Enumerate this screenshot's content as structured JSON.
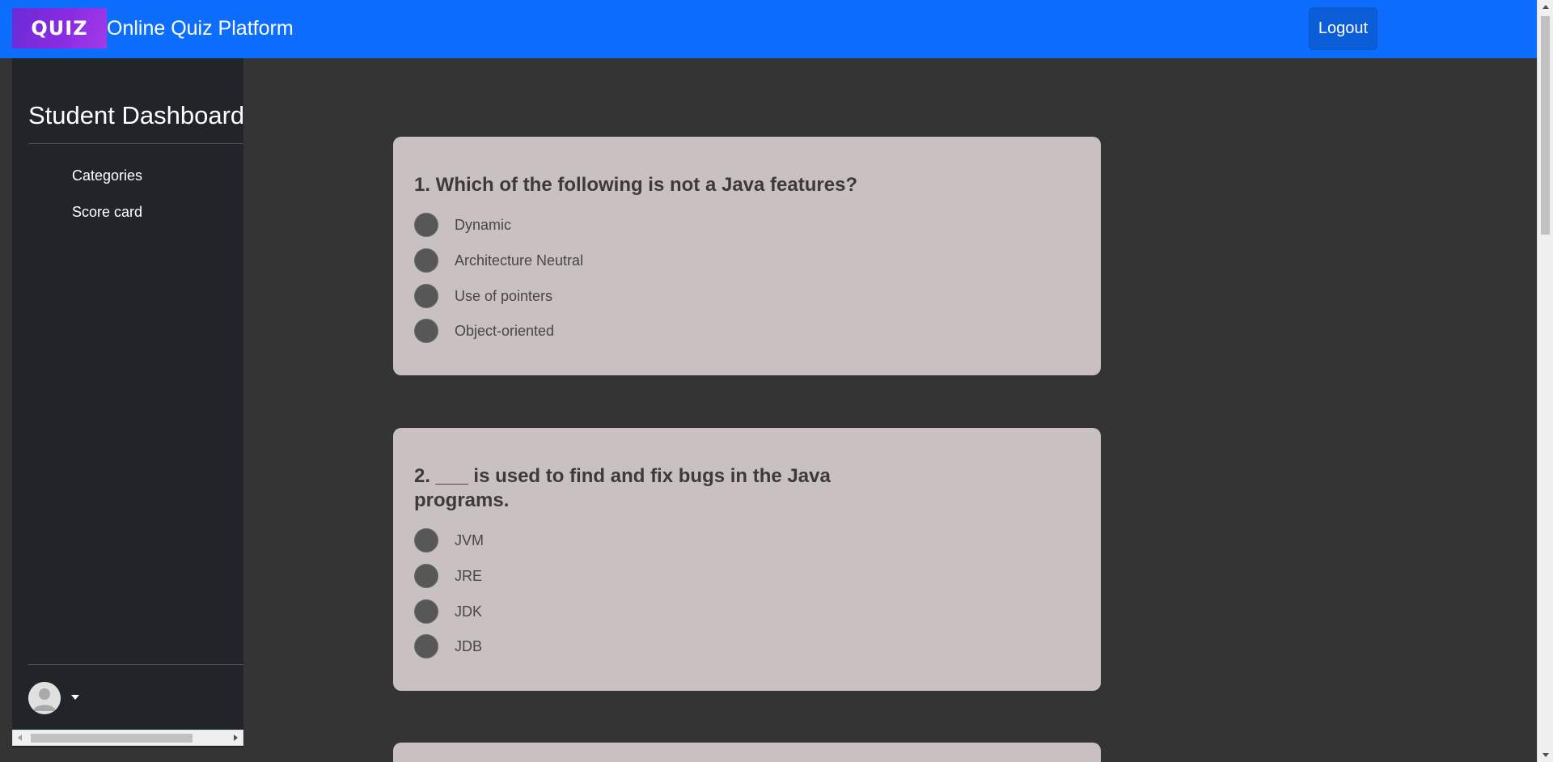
{
  "header": {
    "logo_text": "QUIZ",
    "title": "Online Quiz Platform",
    "logout_label": "Logout"
  },
  "sidebar": {
    "title": "Student Dashboard",
    "items": [
      {
        "label": "Categories"
      },
      {
        "label": "Score card"
      }
    ]
  },
  "questions": [
    {
      "title": "1. Which of the following is not a Java features?",
      "options": [
        "Dynamic",
        "Architecture Neutral",
        "Use of pointers",
        "Object-oriented"
      ]
    },
    {
      "title": "2. ___ is used to find and fix bugs in the Java programs.",
      "options": [
        "JVM",
        "JRE",
        "JDK",
        "JDB"
      ]
    }
  ],
  "colors": {
    "navbar": "#0d6efd",
    "logout_button": "#0b5ed7",
    "sidebar": "#212529",
    "page_background": "#343434",
    "card": "#c9c1c1",
    "radio": "#575757"
  }
}
